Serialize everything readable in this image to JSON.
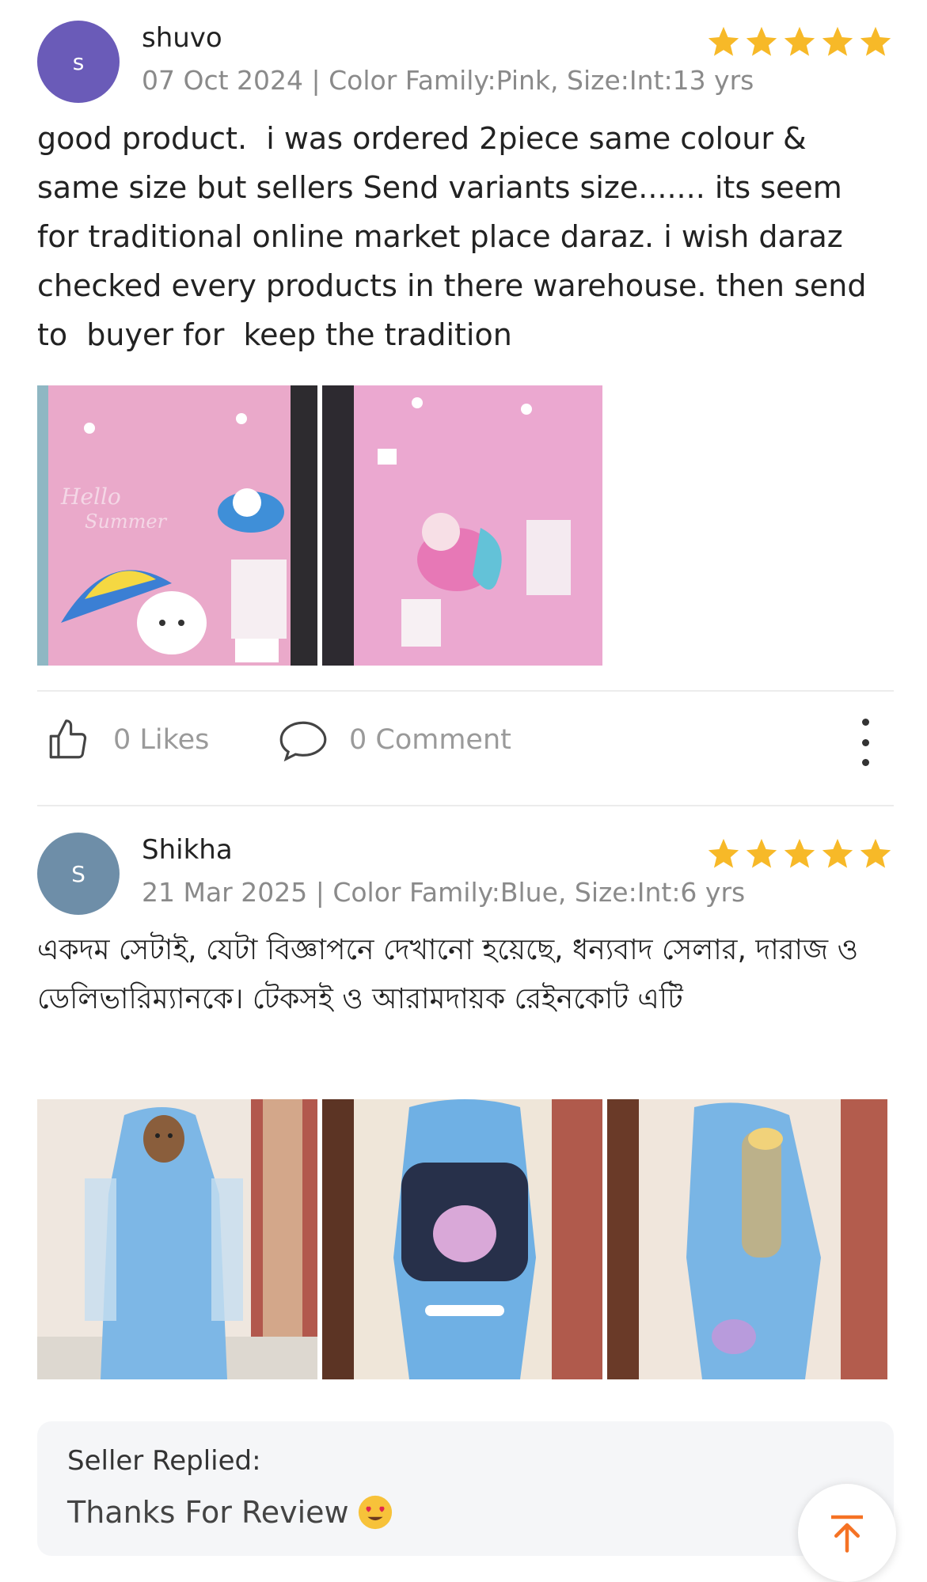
{
  "reviews": [
    {
      "avatar_letter": "s",
      "avatar_color": "#6a5bb8",
      "name": "shuvo",
      "meta": "07 Oct 2024 | Color Family:Pink, Size:Int:13 yrs",
      "rating": 5,
      "text": "good product.  i was ordered 2piece same colour & same size but sellers Send variants size....... its seem for traditional online market place daraz. i wish daraz checked every products in there warehouse. then send to  buyer for  keep the tradition",
      "photos": [
        "pink-raincoat-package-bunny",
        "pink-raincoat-package-mermaid"
      ]
    },
    {
      "avatar_letter": "S",
      "avatar_color": "#6e8ea8",
      "name": "Shikha",
      "meta": "21 Mar 2025 | Color Family:Blue, Size:Int:6 yrs",
      "rating": 5,
      "text": "একদম সেটাই, যেটা বিজ্ঞাপনে দেখানো হয়েছে, ধন্যবাদ সেলার, দারাজ ও ডেলিভারিম্যানকে। টেকসই ও আরামদায়ক রেইনকোট এটি",
      "photos": [
        "child-in-blue-raincoat",
        "blue-raincoat-back-unicorn",
        "blue-raincoat-side"
      ]
    }
  ],
  "actions": {
    "likes_label": "0 Likes",
    "comment_label": "0 Comment"
  },
  "seller_reply": {
    "title": "Seller Replied:",
    "text": "Thanks For Review"
  },
  "colors": {
    "star": "#f7b928",
    "accent": "#f57224"
  }
}
